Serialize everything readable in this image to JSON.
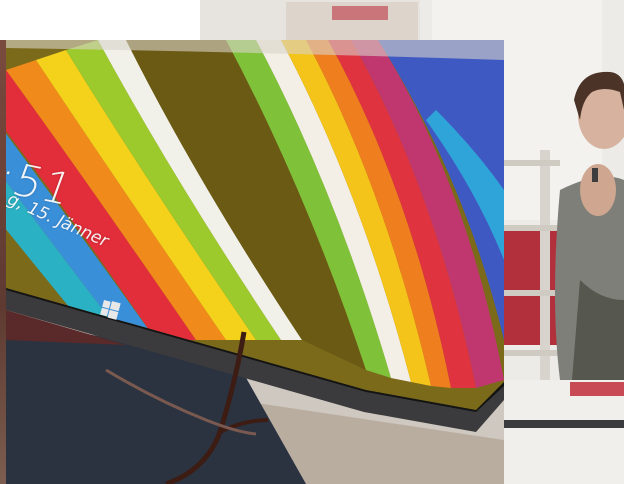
{
  "lock_screen": {
    "time": ":51",
    "date": "g, 15. Jänner"
  },
  "icons": {
    "windows_logo": "windows-logo-icon"
  },
  "colors": {
    "tablet_bezel": "#141414",
    "wallpaper_olive": "#7a6a1a",
    "keyboard_cover": "#2b3340",
    "sweater": "#7d7f78",
    "chair_red": "#b1303c"
  }
}
